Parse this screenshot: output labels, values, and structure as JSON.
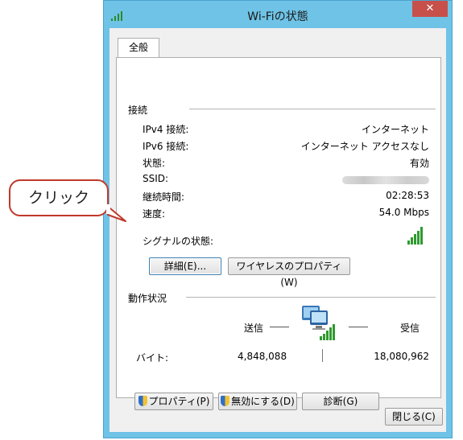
{
  "window": {
    "title": "Wi-Fiの状態",
    "close_glyph": "✕"
  },
  "tab": {
    "label": "全般"
  },
  "connection": {
    "heading": "接続",
    "rows": [
      {
        "label": "IPv4 接続:",
        "value": "インターネット"
      },
      {
        "label": "IPv6 接続:",
        "value": "インターネット アクセスなし"
      },
      {
        "label": "状態:",
        "value": "有効"
      },
      {
        "label": "SSID:",
        "value": ""
      },
      {
        "label": "継続時間:",
        "value": "02:28:53"
      },
      {
        "label": "速度:",
        "value": "54.0 Mbps"
      },
      {
        "label": "シグナルの状態:",
        "value": ""
      }
    ],
    "details_button": "詳細(E)...",
    "wireless_props_button": "ワイヤレスのプロパティ(W)"
  },
  "activity": {
    "heading": "動作状況",
    "sent": "送信",
    "received": "受信",
    "bytes_label": "バイト:",
    "bytes_sent": "4,848,088",
    "bytes_received": "18,080,962"
  },
  "buttons": {
    "properties": "プロパティ(P)",
    "disable": "無効にする(D)",
    "diagnose": "診断(G)",
    "close": "閉じる(C)"
  },
  "callout": {
    "text": "クリック"
  },
  "colors": {
    "title_bar": "#6fc3e6",
    "close_button": "#c7504a",
    "signal_green": "#2f9a2f",
    "callout_border": "#c0392b"
  },
  "icons": [
    "wifi-signal-icon",
    "close-icon",
    "signal-strength-icon",
    "network-computer-icon",
    "shield-icon"
  ]
}
